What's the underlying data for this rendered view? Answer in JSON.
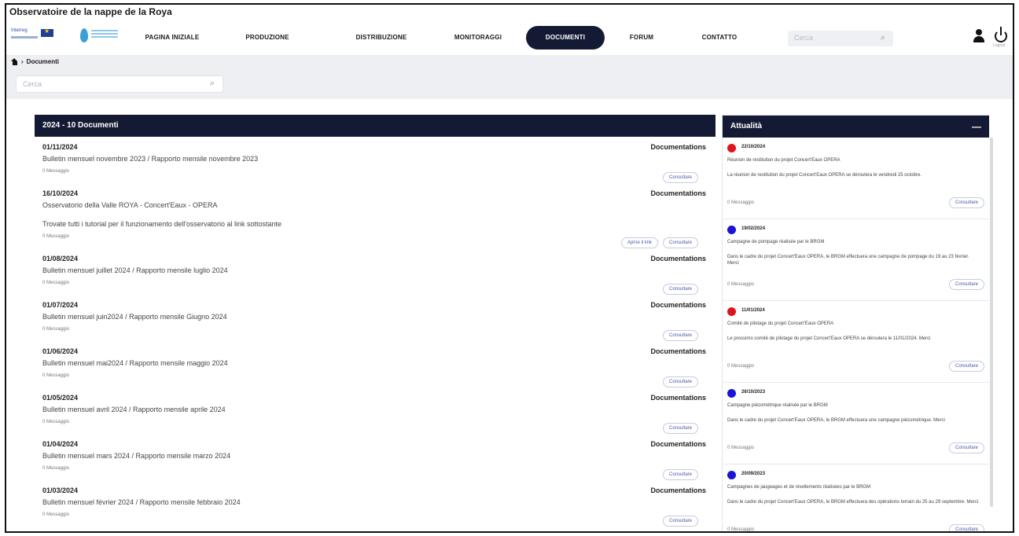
{
  "app_title": "Observatoire de la nappe de la Roya",
  "logos": {
    "interreg": "Interreg",
    "interreg_sub": "ALCOTRA"
  },
  "nav": [
    {
      "label": "PAGINA INIZIALE",
      "active": false
    },
    {
      "label": "PRODUZIONE",
      "active": false
    },
    {
      "label": "DISTRIBUZIONE",
      "active": false
    },
    {
      "label": "MONITORAGGI",
      "active": false
    },
    {
      "label": "DOCUMENTI",
      "active": true
    },
    {
      "label": "FORUM",
      "active": false
    },
    {
      "label": "CONTATTO",
      "active": false
    }
  ],
  "top_search": {
    "placeholder": "Cerca"
  },
  "power_label": "Logout",
  "breadcrumb": {
    "current": "Documenti"
  },
  "main_search": {
    "placeholder": "Cerca"
  },
  "docs": {
    "header": "2024 - 10 Documenti",
    "items": [
      {
        "date": "01/11/2024",
        "category": "Documentations",
        "title": "Bulletin mensuel novembre 2023 / Rapporto mensile novembre 2023",
        "messages": "0 Messaggio",
        "extra": "",
        "buttons": [
          "Consultare"
        ]
      },
      {
        "date": "16/10/2024",
        "category": "Documentations",
        "title": "Osservatorio della Valle ROYA - Concert'Eaux - OPERA",
        "messages": "0 Messaggio",
        "extra": "Trovate tutti i tutorial per il funzionamento dell'osservatorio al link sottostante",
        "buttons": [
          "Aprire il link",
          "Consultare"
        ]
      },
      {
        "date": "01/08/2024",
        "category": "Documentations",
        "title": "Bulletin mensuel juillet 2024 / Rapporto mensile luglio 2024",
        "messages": "0 Messaggio",
        "extra": "",
        "buttons": [
          "Consultare"
        ]
      },
      {
        "date": "01/07/2024",
        "category": "Documentations",
        "title": "Bulletin mensuel juin2024 / Rapporto mensile Giugno 2024",
        "messages": "0 Messaggio",
        "extra": "",
        "buttons": [
          "Consultare"
        ]
      },
      {
        "date": "01/06/2024",
        "category": "Documentations",
        "title": "Bulletin mensuel mai2024 / Rapporto mensile maggio 2024",
        "messages": "0 Messaggio",
        "extra": "",
        "buttons": [
          "Consultare"
        ]
      },
      {
        "date": "01/05/2024",
        "category": "Documentations",
        "title": "Bulletin mensuel avril 2024 / Rapporto mensile aprile 2024",
        "messages": "0 Messaggio",
        "extra": "",
        "buttons": [
          "Consultare"
        ]
      },
      {
        "date": "01/04/2024",
        "category": "Documentations",
        "title": "Bulletin mensuel mars 2024 / Rapporto mensile marzo 2024",
        "messages": "0 Messaggio",
        "extra": "",
        "buttons": [
          "Consultare"
        ]
      },
      {
        "date": "01/03/2024",
        "category": "Documentations",
        "title": "Bulletin mensuel février 2024 / Rapporto mensile febbraio 2024",
        "messages": "0 Messaggio",
        "extra": "",
        "buttons": [
          "Consultare"
        ]
      }
    ]
  },
  "news": {
    "header": "Attualità",
    "collapse": "—",
    "items": [
      {
        "color": "#e0141e",
        "date": "22/10/2024",
        "title": "Réunion de restitution du projet Concert'Eaux OPERA",
        "desc": "La réunion de restitution du projet Concert'Eaux OPERA se déroulera le vendredi 25 octobre.",
        "messages": "0 Messaggio",
        "button": "Consultare"
      },
      {
        "color": "#1a14d8",
        "date": "19/02/2024",
        "title": "Campagne de pompage réalisée par le BRGM",
        "desc": "Dans le cadre du projet Concert'Eaux OPERA, le BRGM effectuera une campagne de pompage du 19 au 23 février. Merci",
        "messages": "0 Messaggio",
        "button": "Consultare"
      },
      {
        "color": "#e0141e",
        "date": "11/01/2024",
        "title": "Comité de pilotage du projet Concert'Eaux OPERA",
        "desc": "Le prossimo comité de pilotage du projet Concert'Eaux OPERA se déroulera le 11/01/2024. Merci",
        "messages": "0 Messaggio",
        "button": "Consultare"
      },
      {
        "color": "#1a14d8",
        "date": "26/10/2023",
        "title": "Campagne piézométrique réalisée par le BRGM",
        "desc": "Dans le cadre du projet Concert'Eaux OPERA, le BRGM effectuera une campagne piézométrique. Merci",
        "messages": "0 Messaggio",
        "button": "Consultare"
      },
      {
        "color": "#1a14d8",
        "date": "20/09/2023",
        "title": "Campagnes de jaugeages et de nivellements réalisées par le BRGM",
        "desc": "Dans le cadre du projet Concert'Eaux OPERA, le BRGM effectuera des opérations terrain du 25 au 29 septembre. Merci",
        "messages": "0 Messaggio",
        "button": "Consultare"
      }
    ]
  }
}
